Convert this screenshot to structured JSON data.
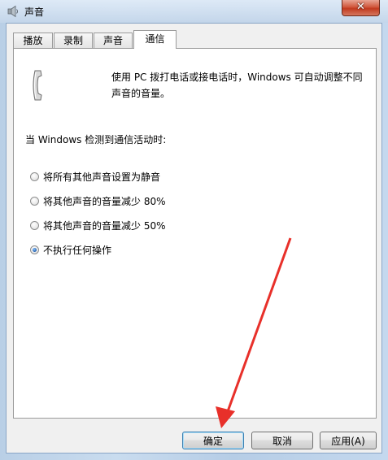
{
  "window": {
    "title": "声音",
    "close_glyph": "✕"
  },
  "tabs": [
    {
      "label": "播放",
      "active": false
    },
    {
      "label": "录制",
      "active": false
    },
    {
      "label": "声音",
      "active": false
    },
    {
      "label": "通信",
      "active": true
    }
  ],
  "communications": {
    "icon": "phone-icon",
    "description_line1": "使用 PC 拨打电话或接电话时，Windows 可自动调整不同",
    "description_line2": "声音的音量。",
    "when_label": "当 Windows 检测到通信活动时:",
    "options": [
      {
        "label": "将所有其他声音设置为静音",
        "checked": false
      },
      {
        "label": "将其他声音的音量减少 80%",
        "checked": false
      },
      {
        "label": "将其他声音的音量减少 50%",
        "checked": false
      },
      {
        "label": "不执行任何操作",
        "checked": true
      }
    ]
  },
  "buttons": {
    "ok": "确定",
    "cancel": "取消",
    "apply": "应用(A)"
  },
  "colors": {
    "annotation_arrow": "#e8302a",
    "accent": "#3c7fb1"
  }
}
